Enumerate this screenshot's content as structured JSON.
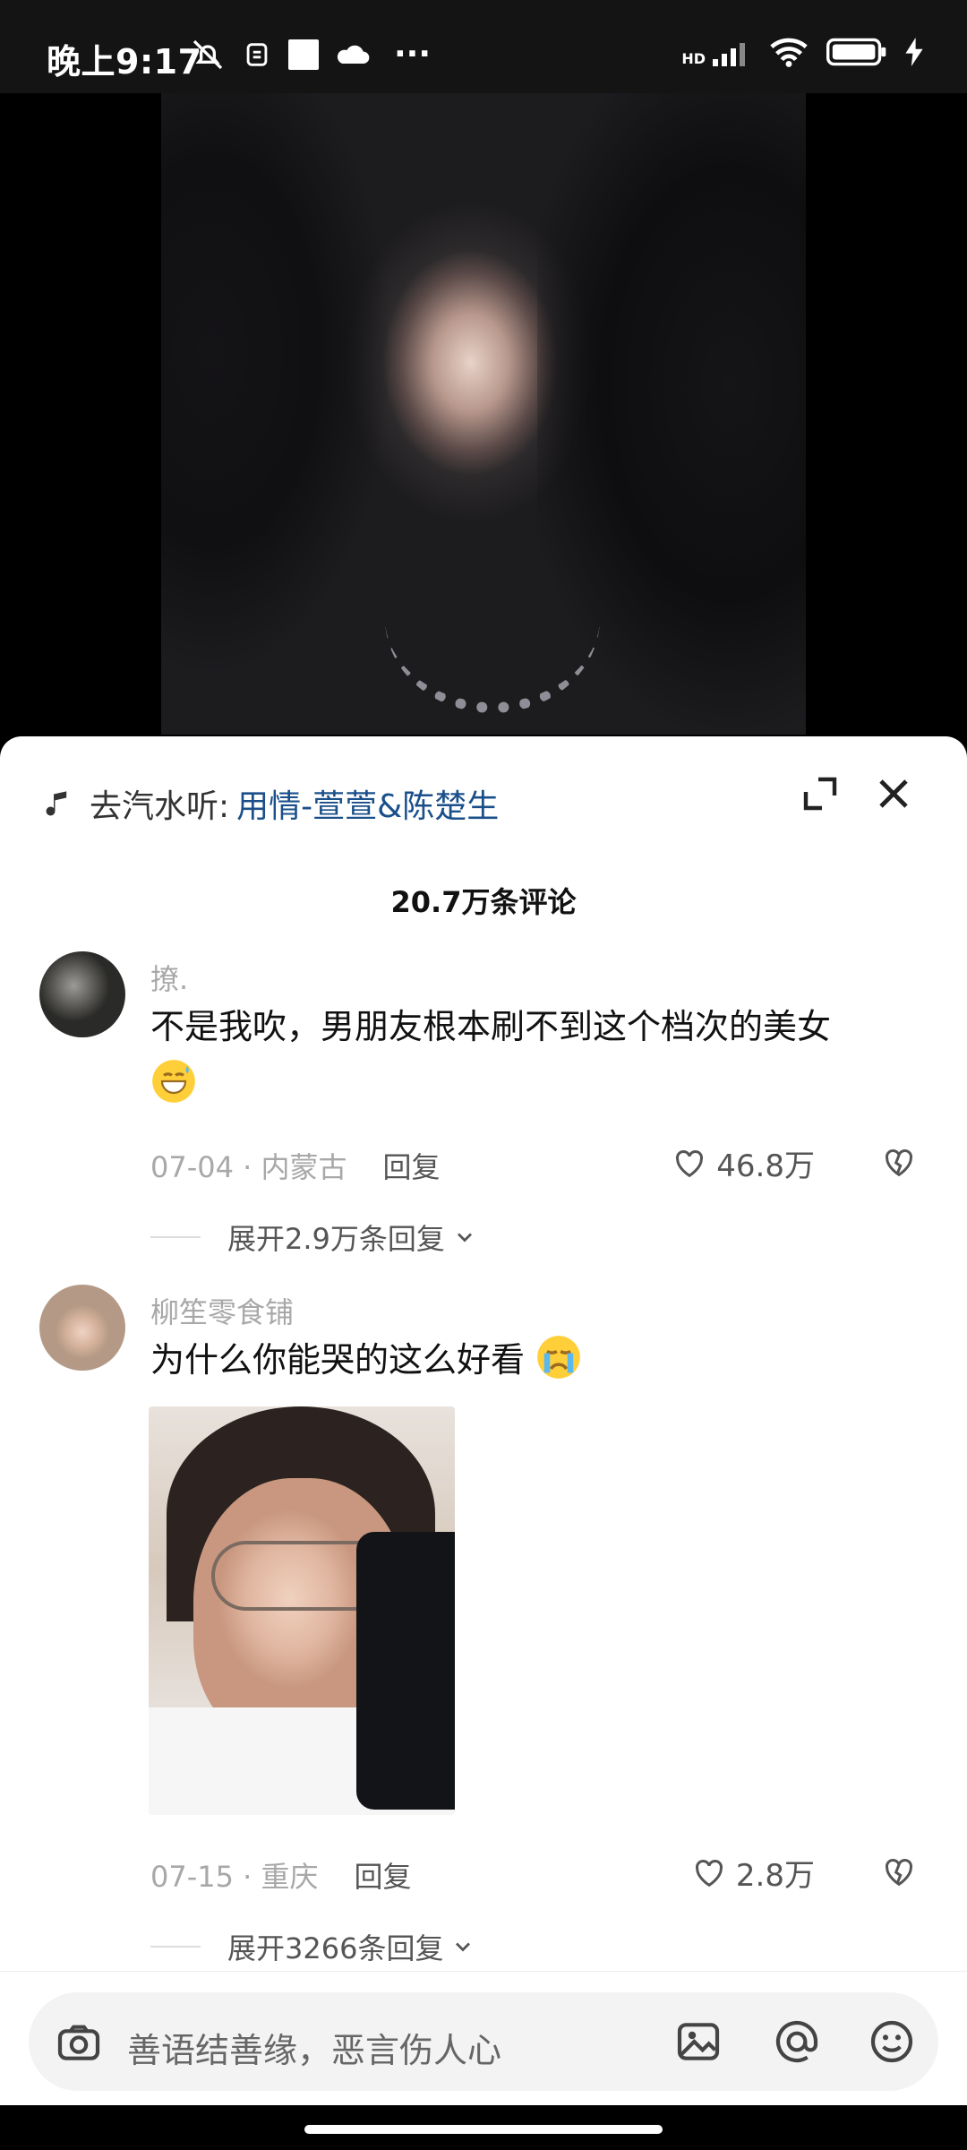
{
  "status": {
    "time": "晚上9:17",
    "dots": "···",
    "network": "HD"
  },
  "music": {
    "prefix": "去汽水听:",
    "song": "用情-萱萱&陈楚生"
  },
  "comments_title": "20.7万条评论",
  "comments": [
    {
      "username": "撩.",
      "text": "不是我吹，男朋友根本刷不到这个档次的美女",
      "date_location": "07-04 · 内蒙古",
      "reply_label": "回复",
      "likes": "46.8万",
      "expand_label": "展开2.9万条回复"
    },
    {
      "username": "柳笙零食铺",
      "text": "为什么你能哭的这么好看",
      "date_location": "07-15 · 重庆",
      "reply_label": "回复",
      "likes": "2.8万",
      "expand_label": "展开3266条回复"
    }
  ],
  "input": {
    "placeholder": "善语结善缘，恶言伤人心"
  },
  "colors": {
    "link": "#1a4f8a",
    "muted": "#a8a8a8",
    "background": "#ffffff"
  }
}
